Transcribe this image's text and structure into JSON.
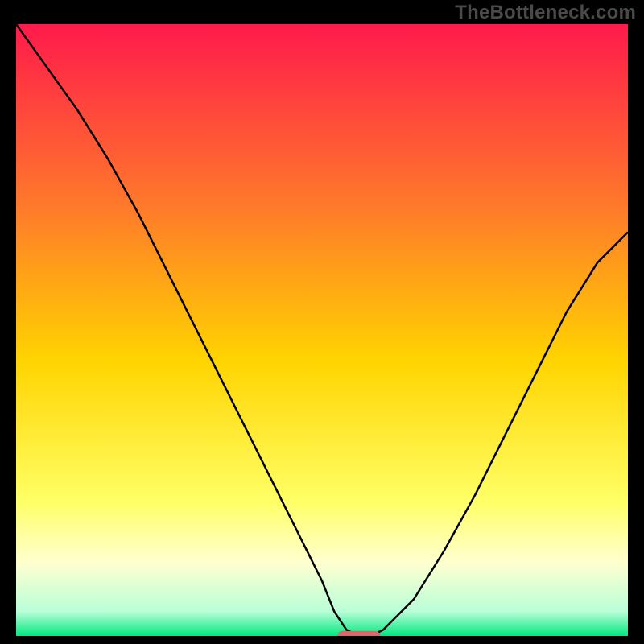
{
  "watermark": "TheBottleneck.com",
  "colors": {
    "frame_bg": "#000000",
    "gradient_top": "#ff1a4b",
    "gradient_mid_upper": "#ff8a2a",
    "gradient_mid": "#ffe000",
    "gradient_pale": "#ffffc0",
    "gradient_bottom": "#00e880",
    "curve_stroke": "#000000",
    "marker_fill": "#d66a6a"
  },
  "chart_data": {
    "type": "line",
    "title": "",
    "xlabel": "",
    "ylabel": "",
    "xlim": [
      0,
      100
    ],
    "ylim": [
      0,
      100
    ],
    "series": [
      {
        "name": "bottleneck-curve",
        "x": [
          0,
          5,
          10,
          15,
          20,
          25,
          30,
          35,
          40,
          45,
          50,
          52,
          54,
          56,
          58,
          60,
          65,
          70,
          75,
          80,
          85,
          90,
          95,
          100
        ],
        "y": [
          100,
          93,
          86,
          78,
          69,
          59,
          49,
          39,
          29,
          19,
          9,
          4,
          1,
          0,
          0,
          1,
          6,
          14,
          23,
          33,
          43,
          53,
          61,
          66
        ]
      }
    ],
    "marker": {
      "name": "optimal-point",
      "x": 56,
      "y": 0,
      "width": 7,
      "height": 1.6
    },
    "gradient_stops": [
      {
        "offset": 0,
        "color": "#ff1a4b"
      },
      {
        "offset": 30,
        "color": "#ff7a2a"
      },
      {
        "offset": 55,
        "color": "#ffd400"
      },
      {
        "offset": 78,
        "color": "#ffff66"
      },
      {
        "offset": 88,
        "color": "#ffffd0"
      },
      {
        "offset": 96,
        "color": "#b8ffd8"
      },
      {
        "offset": 100,
        "color": "#00e880"
      }
    ]
  }
}
